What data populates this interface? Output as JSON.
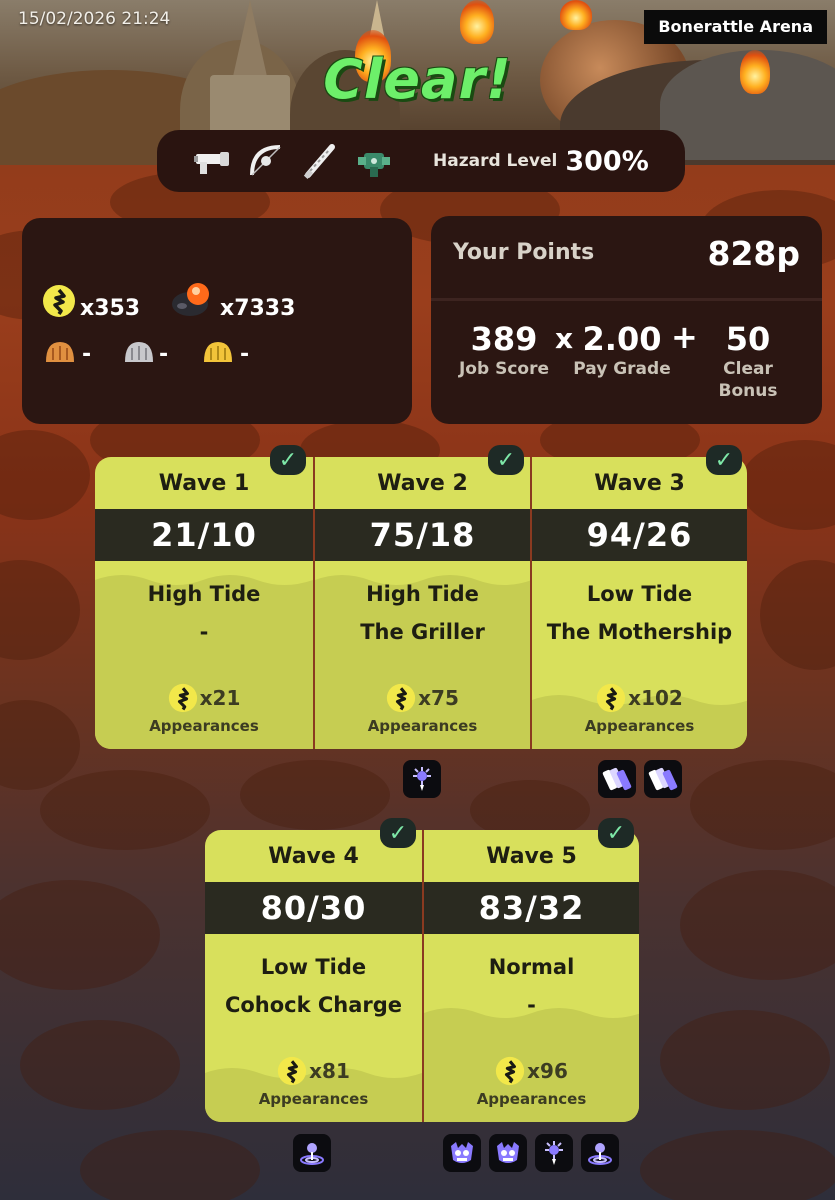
{
  "timestamp": "15/02/2026 21:24",
  "stage_name": "Bonerattle Arena",
  "result_title": "Clear!",
  "weapons": [
    {
      "icon": "blaster-weapon-icon"
    },
    {
      "icon": "stringer-weapon-icon"
    },
    {
      "icon": "splatana-weapon-icon"
    },
    {
      "icon": "dualies-weapon-icon"
    }
  ],
  "hazard": {
    "label": "Hazard Level",
    "value": "300%"
  },
  "eggs": {
    "golden": "x353",
    "power": "x7333",
    "bronze_scale": "-",
    "silver_scale": "-",
    "gold_scale": "-"
  },
  "points": {
    "label": "Your Points",
    "value": "828p",
    "job_score": "389",
    "job_score_label": "Job Score",
    "times": "x",
    "pay_grade": "2.00",
    "pay_grade_label": "Pay Grade",
    "plus": "+",
    "clear_bonus": "50",
    "clear_bonus_label_1": "Clear",
    "clear_bonus_label_2": "Bonus"
  },
  "waves": [
    {
      "title": "Wave 1",
      "score": "21/10",
      "tide": "High Tide",
      "event": "-",
      "eggs": "x21",
      "appear_label": "Appearances",
      "cleared": true,
      "specials": []
    },
    {
      "title": "Wave 2",
      "score": "75/18",
      "tide": "High Tide",
      "event": "The Griller",
      "eggs": "x75",
      "appear_label": "Appearances",
      "cleared": true,
      "specials": [
        "killer-wail-special-icon"
      ]
    },
    {
      "title": "Wave 3",
      "score": "94/26",
      "tide": "Low Tide",
      "event": "The Mothership",
      "eggs": "x102",
      "appear_label": "Appearances",
      "cleared": true,
      "specials": [
        "triple-splashdown-special-icon",
        "triple-splashdown-special-icon"
      ]
    },
    {
      "title": "Wave 4",
      "score": "80/30",
      "tide": "Low Tide",
      "event": "Cohock Charge",
      "eggs": "x81",
      "appear_label": "Appearances",
      "cleared": true,
      "specials": [
        "booyah-bomb-special-icon"
      ]
    },
    {
      "title": "Wave 5",
      "score": "83/32",
      "tide": "Normal",
      "event": "-",
      "eggs": "x96",
      "appear_label": "Appearances",
      "cleared": true,
      "specials": [
        "reefslider-special-icon",
        "reefslider-special-icon",
        "killer-wail-special-icon",
        "booyah-bomb-special-icon"
      ]
    }
  ],
  "check_mark": "✓",
  "colors": {
    "wave_card": "#d8e05c",
    "clear_green": "#6df06a",
    "panel": "#2b1612"
  }
}
